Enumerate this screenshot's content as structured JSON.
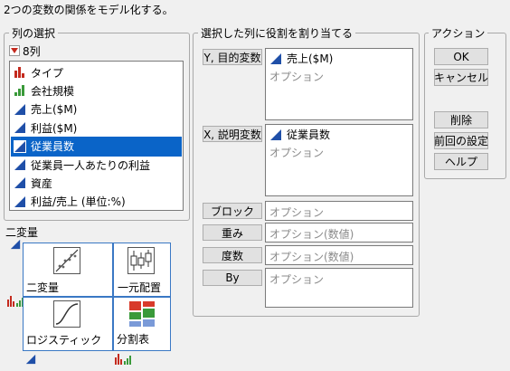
{
  "header": {
    "description": "2つの変数の関係をモデル化する。"
  },
  "column_select": {
    "title": "列の選択",
    "count_label": "8列",
    "items": [
      {
        "label": "タイプ",
        "icon": "nominal-bar-icon",
        "selected": false
      },
      {
        "label": "会社規模",
        "icon": "ordinal-bar-icon",
        "selected": false
      },
      {
        "label": "売上($M)",
        "icon": "continuous-triangle-icon",
        "selected": false
      },
      {
        "label": "利益($M)",
        "icon": "continuous-triangle-icon",
        "selected": false
      },
      {
        "label": "従業員数",
        "icon": "continuous-triangle-icon",
        "selected": true
      },
      {
        "label": "従業員一人あたりの利益",
        "icon": "continuous-triangle-icon",
        "selected": false
      },
      {
        "label": "資産",
        "icon": "continuous-triangle-icon",
        "selected": false
      },
      {
        "label": "利益/売上 (単位:%)",
        "icon": "continuous-triangle-icon",
        "selected": false
      }
    ]
  },
  "roles": {
    "title": "選択した列に役割を割り当てる",
    "y_button": "Y, 目的変数",
    "y_value": "売上($M)",
    "y_placeholder": "オプション",
    "x_button": "X, 説明変数",
    "x_value": "従業員数",
    "x_placeholder": "オプション",
    "block_button": "ブロック",
    "block_placeholder": "オプション",
    "weight_button": "重み",
    "weight_placeholder": "オプション(数値)",
    "freq_button": "度数",
    "freq_placeholder": "オプション(数値)",
    "by_button": "By",
    "by_placeholder": "オプション"
  },
  "actions": {
    "title": "アクション",
    "ok": "OK",
    "cancel": "キャンセル",
    "remove": "削除",
    "recall": "前回の設定",
    "help": "ヘルプ"
  },
  "bivariate": {
    "title": "二変量",
    "cells": {
      "bivariate": "二変量",
      "oneway": "一元配置",
      "logistic": "ロジスティック",
      "contingency": "分割表"
    }
  },
  "colors": {
    "continuous": "#1f4fa8",
    "nominal": "#c42a1e",
    "ordinal": "#3a9a3a",
    "selection": "#0a64c8",
    "cell_border": "#3a78c4"
  }
}
